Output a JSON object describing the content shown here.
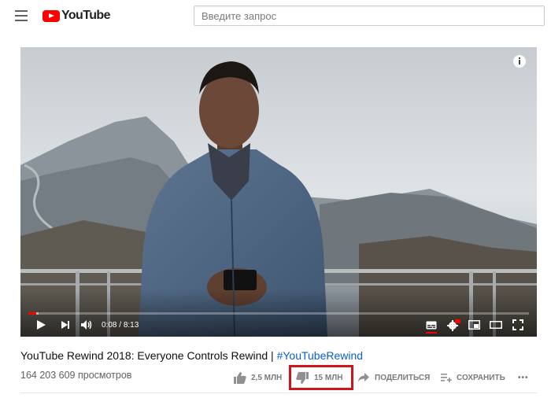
{
  "header": {
    "logo_text": "YouTube",
    "search_placeholder": "Введите запрос"
  },
  "player": {
    "time_current": "0:08",
    "time_separator": " / ",
    "time_total": "8:13",
    "progress_played_fraction": 0.016,
    "progress_loaded_fraction": 0.02
  },
  "video": {
    "title": "YouTube Rewind 2018: Everyone Controls Rewind | ",
    "hashtag": "#YouTubeRewind",
    "views": "164 203 609 просмотров",
    "likes": "2,5 МЛН",
    "dislikes": "15 МЛН",
    "share_label": "ПОДЕЛИТЬСЯ",
    "save_label": "СОХРАНИТЬ",
    "more_label": "•••"
  },
  "colors": {
    "brand_red": "#ff0000",
    "link_blue": "#065fd4",
    "highlight_red": "#d0141b"
  }
}
